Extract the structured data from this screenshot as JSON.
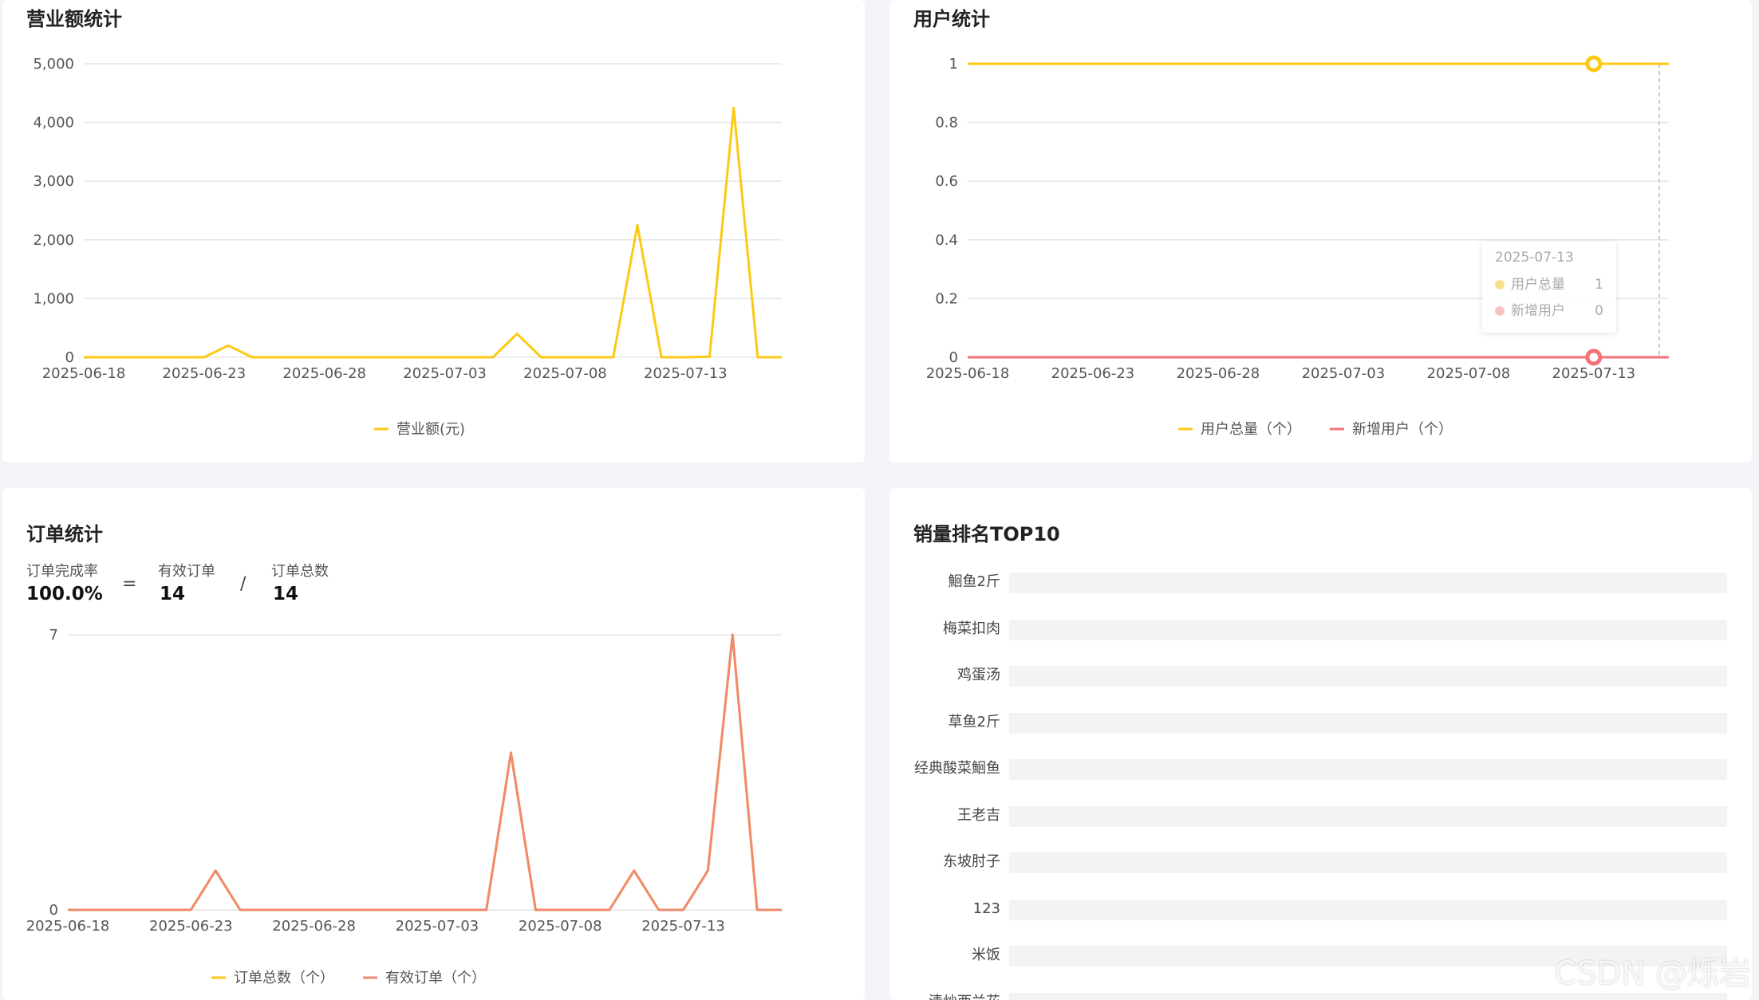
{
  "revenue": {
    "title": "营业额统计",
    "chart_data": {
      "type": "line",
      "x": [
        "2025-06-18",
        "2025-06-19",
        "2025-06-20",
        "2025-06-21",
        "2025-06-22",
        "2025-06-23",
        "2025-06-24",
        "2025-06-25",
        "2025-06-26",
        "2025-06-27",
        "2025-06-28",
        "2025-06-29",
        "2025-06-30",
        "2025-07-01",
        "2025-07-02",
        "2025-07-03",
        "2025-07-04",
        "2025-07-05",
        "2025-07-06",
        "2025-07-07",
        "2025-07-08",
        "2025-07-09",
        "2025-07-10",
        "2025-07-11",
        "2025-07-12",
        "2025-07-13",
        "2025-07-14",
        "2025-07-15",
        "2025-07-16",
        "2025-07-17"
      ],
      "tick_labels": [
        "2025-06-18",
        "2025-06-23",
        "2025-06-28",
        "2025-07-03",
        "2025-07-08",
        "2025-07-13"
      ],
      "y_ticks": [
        "0",
        "1,000",
        "2,000",
        "3,000",
        "4,000",
        "5,000"
      ],
      "ylim": [
        0,
        5000
      ],
      "series": [
        {
          "name": "营业额(元)",
          "color": "#fcc915",
          "values": [
            0,
            0,
            0,
            0,
            0,
            0,
            200,
            0,
            0,
            0,
            0,
            0,
            0,
            0,
            0,
            0,
            0,
            0,
            400,
            0,
            0,
            0,
            0,
            2250,
            0,
            0,
            10,
            4250,
            0,
            0
          ]
        }
      ],
      "legend": "bottom-center"
    }
  },
  "users": {
    "title": "用户统计",
    "chart_data": {
      "type": "line",
      "x": [
        "2025-06-18",
        "2025-06-19",
        "2025-06-20",
        "2025-06-21",
        "2025-06-22",
        "2025-06-23",
        "2025-06-24",
        "2025-06-25",
        "2025-06-26",
        "2025-06-27",
        "2025-06-28",
        "2025-06-29",
        "2025-06-30",
        "2025-07-01",
        "2025-07-02",
        "2025-07-03",
        "2025-07-04",
        "2025-07-05",
        "2025-07-06",
        "2025-07-07",
        "2025-07-08",
        "2025-07-09",
        "2025-07-10",
        "2025-07-11",
        "2025-07-12",
        "2025-07-13",
        "2025-07-14",
        "2025-07-15",
        "2025-07-16"
      ],
      "tick_labels": [
        "2025-06-18",
        "2025-06-23",
        "2025-06-28",
        "2025-07-03",
        "2025-07-08",
        "2025-07-13"
      ],
      "y_ticks": [
        "0",
        "0.2",
        "0.4",
        "0.6",
        "0.8",
        "1"
      ],
      "ylim": [
        0,
        1
      ],
      "series": [
        {
          "name": "用户总量（个）",
          "color": "#fcc915",
          "values": [
            1,
            1,
            1,
            1,
            1,
            1,
            1,
            1,
            1,
            1,
            1,
            1,
            1,
            1,
            1,
            1,
            1,
            1,
            1,
            1,
            1,
            1,
            1,
            1,
            1,
            1,
            1,
            1,
            1
          ]
        },
        {
          "name": "新增用户（个）",
          "color": "#f3727a",
          "values": [
            0,
            0,
            0,
            0,
            0,
            0,
            0,
            0,
            0,
            0,
            0,
            0,
            0,
            0,
            0,
            0,
            0,
            0,
            0,
            0,
            0,
            0,
            0,
            0,
            0,
            0,
            0,
            0,
            0
          ]
        }
      ],
      "legend": "bottom-center"
    },
    "tooltip": {
      "date": "2025-07-13",
      "rows": [
        {
          "name": "用户总量",
          "value": "1",
          "color": "#fbe08a"
        },
        {
          "name": "新增用户",
          "value": "0",
          "color": "#f9c0c4"
        }
      ]
    }
  },
  "orders": {
    "title": "订单统计",
    "stats": {
      "rate_label": "订单完成率",
      "rate_value": "100.0%",
      "equals": "=",
      "valid_label": "有效订单",
      "valid_value": "14",
      "divide": "/",
      "total_label": "订单总数",
      "total_value": "14"
    },
    "chart_data": {
      "type": "line",
      "x": [
        "2025-06-18",
        "2025-06-19",
        "2025-06-20",
        "2025-06-21",
        "2025-06-22",
        "2025-06-23",
        "2025-06-24",
        "2025-06-25",
        "2025-06-26",
        "2025-06-27",
        "2025-06-28",
        "2025-06-29",
        "2025-06-30",
        "2025-07-01",
        "2025-07-02",
        "2025-07-03",
        "2025-07-04",
        "2025-07-05",
        "2025-07-06",
        "2025-07-07",
        "2025-07-08",
        "2025-07-09",
        "2025-07-10",
        "2025-07-11",
        "2025-07-12",
        "2025-07-13",
        "2025-07-14",
        "2025-07-15",
        "2025-07-16",
        "2025-07-17"
      ],
      "tick_labels": [
        "2025-06-18",
        "2025-06-23",
        "2025-06-28",
        "2025-07-03",
        "2025-07-08",
        "2025-07-13"
      ],
      "y_ticks": [
        "0",
        "7"
      ],
      "ylim": [
        0,
        7
      ],
      "series": [
        {
          "name": "订单总数（个）",
          "color": "#fcc915",
          "values": [
            0,
            0,
            0,
            0,
            0,
            0,
            1,
            0,
            0,
            0,
            0,
            0,
            0,
            0,
            0,
            0,
            0,
            0,
            4,
            0,
            0,
            0,
            0,
            1,
            0,
            0,
            1,
            7,
            0,
            0
          ]
        },
        {
          "name": "有效订单（个）",
          "color": "#f08a6e",
          "values": [
            0,
            0,
            0,
            0,
            0,
            0,
            1,
            0,
            0,
            0,
            0,
            0,
            0,
            0,
            0,
            0,
            0,
            0,
            4,
            0,
            0,
            0,
            0,
            1,
            0,
            0,
            1,
            7,
            0,
            0
          ]
        }
      ],
      "legend": "bottom-center"
    }
  },
  "top10": {
    "title": "销量排名TOP10",
    "chart_data": {
      "type": "bar",
      "categories": [
        "鮰鱼2斤",
        "梅菜扣肉",
        "鸡蛋汤",
        "草鱼2斤",
        "经典酸菜鮰鱼",
        "王老吉",
        "东坡肘子",
        "123",
        "米饭",
        "清炒西兰花"
      ]
    }
  },
  "watermark": "CSDN @烁岩"
}
